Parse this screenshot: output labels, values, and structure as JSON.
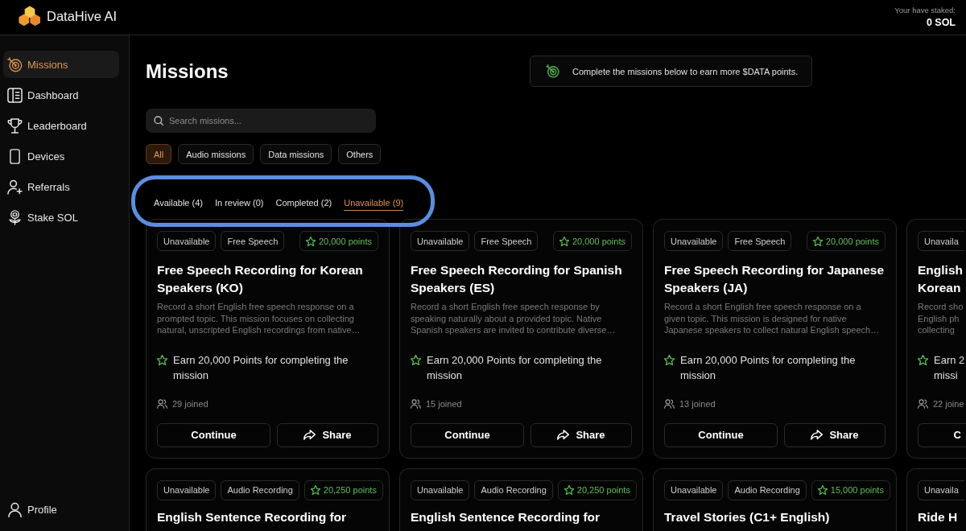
{
  "brand": {
    "name": "DataHive AI"
  },
  "stake": {
    "label": "Your have staked:",
    "amount": "0 SOL"
  },
  "sidebar": {
    "items": [
      {
        "label": "Missions",
        "selected": true
      },
      {
        "label": "Dashboard",
        "selected": false
      },
      {
        "label": "Leaderboard",
        "selected": false
      },
      {
        "label": "Devices",
        "selected": false
      },
      {
        "label": "Referrals",
        "selected": false
      },
      {
        "label": "Stake SOL",
        "selected": false
      }
    ],
    "footer": {
      "label": "Profile"
    }
  },
  "page": {
    "title": "Missions"
  },
  "banner": {
    "text": "Complete the missions below to earn more $DATA points."
  },
  "search": {
    "placeholder": "Search missions..."
  },
  "filters": [
    {
      "label": "All",
      "selected": true
    },
    {
      "label": "Audio missions",
      "selected": false
    },
    {
      "label": "Data missions",
      "selected": false
    },
    {
      "label": "Others",
      "selected": false
    }
  ],
  "status_tabs": {
    "highlighted": true,
    "items": [
      {
        "label": "Available (4)",
        "selected": false
      },
      {
        "label": "In review (0)",
        "selected": false
      },
      {
        "label": "Completed (2)",
        "selected": false
      },
      {
        "label": "Unavailable (9)",
        "selected": true
      }
    ]
  },
  "missions": [
    {
      "status": "Unavailable",
      "category": "Free Speech",
      "points": "20,000 points",
      "title": "Free Speech Recording for Korean\nSpeakers (KO)",
      "description": "Record a short English free speech response on a\nprompted topic. This mission focuses on collecting\nnatural, unscripted English recordings from native…",
      "reward": "Earn 20,000 Points for completing the\nmission",
      "joined": "29 joined",
      "primary_action": "Continue",
      "share_action": "Share"
    },
    {
      "status": "Unavailable",
      "category": "Free Speech",
      "points": "20,000 points",
      "title": "Free Speech Recording for Spanish\nSpeakers (ES)",
      "description": "Record a short English free speech response by\nspeaking naturally about a provided topic. Native\nSpanish speakers are invited to contribute diverse…",
      "reward": "Earn 20,000 Points for completing the\nmission",
      "joined": "15 joined",
      "primary_action": "Continue",
      "share_action": "Share"
    },
    {
      "status": "Unavailable",
      "category": "Free Speech",
      "points": "20,000 points",
      "title": "Free Speech Recording for Japanese\nSpeakers (JA)",
      "description": "Record a short English free speech response on a\ngiven topic. This mission is designed for native\nJapanese speakers to collect natural English speech…",
      "reward": "Earn 20,000 Points for completing the\nmission",
      "joined": "13 joined",
      "primary_action": "Continue",
      "share_action": "Share"
    },
    {
      "status": "Unavaila",
      "title": "English\nKorean",
      "description": "Record sho\nEnglish ph\ncollecting",
      "reward": "Earn 2\nmissi",
      "joined": "22 joine",
      "primary_action": "C"
    },
    {
      "status": "Unavailable",
      "category": "Audio Recording",
      "points": "20,250 points",
      "title": "English Sentence Recording for"
    },
    {
      "status": "Unavailable",
      "category": "Audio Recording",
      "points": "20,250 points",
      "title": "English Sentence Recording for"
    },
    {
      "status": "Unavailable",
      "category": "Audio Recording",
      "points": "15,000 points",
      "title": "Travel Stories (C1+ English)"
    },
    {
      "status": "Unavaila",
      "title": "Ride H"
    }
  ]
}
